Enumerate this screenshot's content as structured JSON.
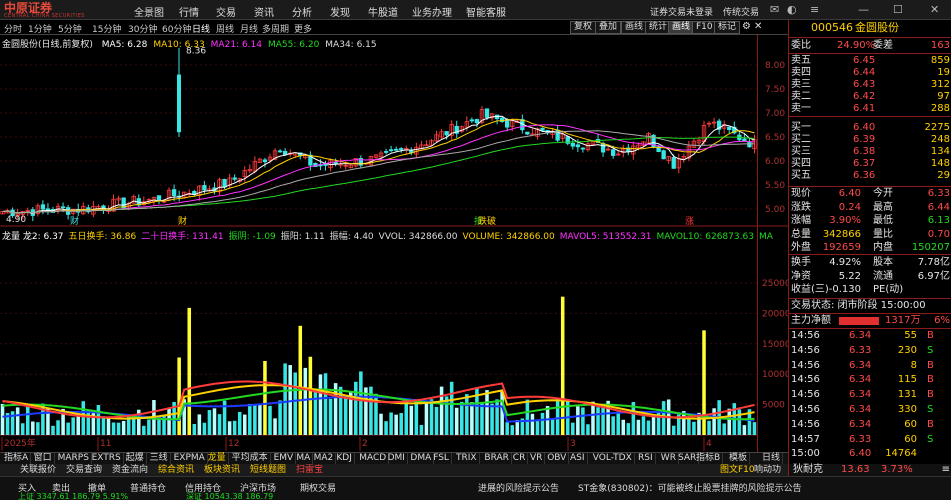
{
  "app": {
    "logo_cn": "中原证券",
    "logo_en": "CENTRAL CHINA SECURITIES"
  },
  "menu": [
    "全景图",
    "行情",
    "交易",
    "资讯",
    "分析",
    "发现",
    "牛股道",
    "业务办理",
    "智能客服"
  ],
  "menu_right": {
    "trade_status": "证券交易未登录",
    "edition": "传统交易"
  },
  "periods": [
    "分时",
    "1分钟",
    "5分钟",
    "15分钟",
    "30分钟",
    "60分钟",
    "日线",
    "周线",
    "月线",
    "多周期",
    "更多"
  ],
  "active_period": "日线",
  "tools": [
    "复权",
    "叠加",
    "画线",
    "统计",
    "画线",
    "F10",
    "标记"
  ],
  "chart": {
    "title": "金圆股份(日线,前复权)",
    "ma_legend": [
      {
        "label": "MA5: 6.28",
        "color": "#ffffff"
      },
      {
        "label": "MA10: 6.33",
        "color": "#ffd100"
      },
      {
        "label": "MA21: 6.14",
        "color": "#ff33ff"
      },
      {
        "label": "MA55: 6.20",
        "color": "#22d822"
      },
      {
        "label": "MA34: 6.15",
        "color": "#dddddd"
      }
    ],
    "max_label": "8.36",
    "min_label": "4.90",
    "price_axis": [
      "8.00",
      "7.50",
      "7.00",
      "6.50",
      "6.00",
      "5.50",
      "5.00"
    ],
    "volume_axis": [
      "25000",
      "20000",
      "15000",
      "10000",
      "5000"
    ],
    "markers": [
      "财",
      "财",
      "抵",
      "跌破",
      "涨"
    ],
    "date_labels": [
      "2025年",
      "11",
      "12",
      "2",
      "3",
      "4"
    ],
    "vol_legend": [
      {
        "label": "龙量 龙2: 6.37",
        "color": "#ffffff"
      },
      {
        "label": "五日换手: 36.86",
        "color": "#ffd100"
      },
      {
        "label": "二十日换手: 131.41",
        "color": "#ff33ff"
      },
      {
        "label": "振阴: -1.09",
        "color": "#22d822"
      },
      {
        "label": "振阳: 1.11",
        "color": "#dddddd"
      },
      {
        "label": "振幅: 4.40",
        "color": "#dddddd"
      },
      {
        "label": "VVOL: 342866.00",
        "color": "#dddddd"
      },
      {
        "label": "VOLUME: 342866.00",
        "color": "#ffd100"
      },
      {
        "label": "MAVOL5: 513552.31",
        "color": "#ff33ff"
      },
      {
        "label": "MAVOL10: 626873.63",
        "color": "#22d822"
      },
      {
        "label": "MA",
        "color": "#22d822"
      }
    ]
  },
  "indicator_tabs": [
    "指标A",
    "窗口",
    "MARPS",
    "EXTRS",
    "起爆",
    "三线",
    "EXPMA",
    "龙量",
    "平均成本",
    "EMV",
    "MA",
    "MA2",
    "KDJ",
    "MACD",
    "DMI",
    "DMA",
    "FSL",
    "TRIX",
    "BRAR",
    "CR",
    "VR",
    "OBV",
    "ASI",
    "VOL-TDX",
    "RSI",
    "WR",
    "SAR"
  ],
  "active_indicator": "龙量",
  "indicator_right": [
    "指标B",
    "模板"
  ],
  "sub_tabs": [
    {
      "label": "关联报价",
      "style": "normal"
    },
    {
      "label": "交易查询",
      "style": "normal"
    },
    {
      "label": "资金流向",
      "style": "normal"
    },
    {
      "label": "综合资讯",
      "style": "yellow"
    },
    {
      "label": "板块资讯",
      "style": "yellow"
    },
    {
      "label": "短线题图",
      "style": "yellow"
    },
    {
      "label": "扫雷宝",
      "style": "red"
    }
  ],
  "sub_right": [
    "图文F10",
    "响动功能"
  ],
  "quote": {
    "code": "000546",
    "name": "金圆股份",
    "webi_label": "委比",
    "webi": "24.90%",
    "wecha_label": "委差",
    "wecha": "163",
    "asks": [
      {
        "label": "卖五",
        "price": "6.45",
        "vol": "859"
      },
      {
        "label": "卖四",
        "price": "6.44",
        "vol": "19"
      },
      {
        "label": "卖三",
        "price": "6.43",
        "vol": "312"
      },
      {
        "label": "卖二",
        "price": "6.42",
        "vol": "97"
      },
      {
        "label": "卖一",
        "price": "6.41",
        "vol": "288"
      }
    ],
    "bids": [
      {
        "label": "买一",
        "price": "6.40",
        "vol": "2275"
      },
      {
        "label": "买二",
        "price": "6.39",
        "vol": "248"
      },
      {
        "label": "买三",
        "price": "6.38",
        "vol": "134"
      },
      {
        "label": "买四",
        "price": "6.37",
        "vol": "148"
      },
      {
        "label": "买五",
        "price": "6.36",
        "vol": "29"
      }
    ],
    "stats": [
      {
        "l1": "现价",
        "v1": "6.40",
        "l2": "今开",
        "v2": "6.33"
      },
      {
        "l1": "涨跌",
        "v1": "0.24",
        "l2": "最高",
        "v2": "6.44"
      },
      {
        "l1": "涨幅",
        "v1": "3.90%",
        "l2": "最低",
        "v2": "6.13"
      },
      {
        "l1": "总量",
        "v1": "342866",
        "l2": "量比",
        "v2": "0.70"
      },
      {
        "l1": "外盘",
        "v1": "192659",
        "l2": "内盘",
        "v2": "150207"
      }
    ],
    "stats2": [
      {
        "l1": "换手",
        "v1": "4.92%",
        "l2": "股本",
        "v2": "7.78亿"
      },
      {
        "l1": "净资",
        "v1": "5.22",
        "l2": "流通",
        "v2": "6.97亿"
      },
      {
        "l1": "收益(三)",
        "v1": "-0.130",
        "l2": "PE(动)",
        "v2": ""
      }
    ],
    "trade_state": "交易状态: 闭市阶段 15:00:00",
    "net_flow_label": "主力净额",
    "net_flow_value": "1317万",
    "net_flow_pct": "6%",
    "ticks": [
      {
        "t": "14:56",
        "p": "6.34",
        "v": "55",
        "d": "B"
      },
      {
        "t": "14:56",
        "p": "6.33",
        "v": "230",
        "d": "S"
      },
      {
        "t": "14:56",
        "p": "6.34",
        "v": "8",
        "d": "B"
      },
      {
        "t": "14:56",
        "p": "6.34",
        "v": "115",
        "d": "B"
      },
      {
        "t": "14:56",
        "p": "6.34",
        "v": "131",
        "d": "B"
      },
      {
        "t": "14:56",
        "p": "6.34",
        "v": "330",
        "d": "S"
      },
      {
        "t": "14:56",
        "p": "6.34",
        "v": "60",
        "d": "B"
      },
      {
        "t": "14:57",
        "p": "6.33",
        "v": "60",
        "d": "S"
      },
      {
        "t": "15:00",
        "p": "6.40",
        "v": "14764",
        "d": ""
      }
    ],
    "bottom_index": {
      "name": "狄耐克",
      "price": "13.63",
      "pct": "3.73%"
    }
  },
  "status_bar": [
    {
      "text": "买入",
      "color": "#dddddd"
    },
    {
      "text": "卖出",
      "color": "#dddddd"
    },
    {
      "text": "撤单",
      "color": "#dddddd"
    },
    {
      "text": "普通持仓",
      "color": "#dddddd"
    },
    {
      "text": "信用持仓",
      "color": "#dddddd"
    },
    {
      "text": "沪深市场",
      "color": "#dddddd"
    },
    {
      "text": "期权交易",
      "color": "#dddddd"
    },
    {
      "text": "上证 3347.61  186.79  5.91%",
      "color": "#22d822"
    },
    {
      "text": "深证 10543.38  186.79",
      "color": "#22d822"
    }
  ],
  "status_ticker": "ST金象(830802)：可能被终止股票挂牌的风险提示公告",
  "status_notice": "进展的风险提示公告"
}
